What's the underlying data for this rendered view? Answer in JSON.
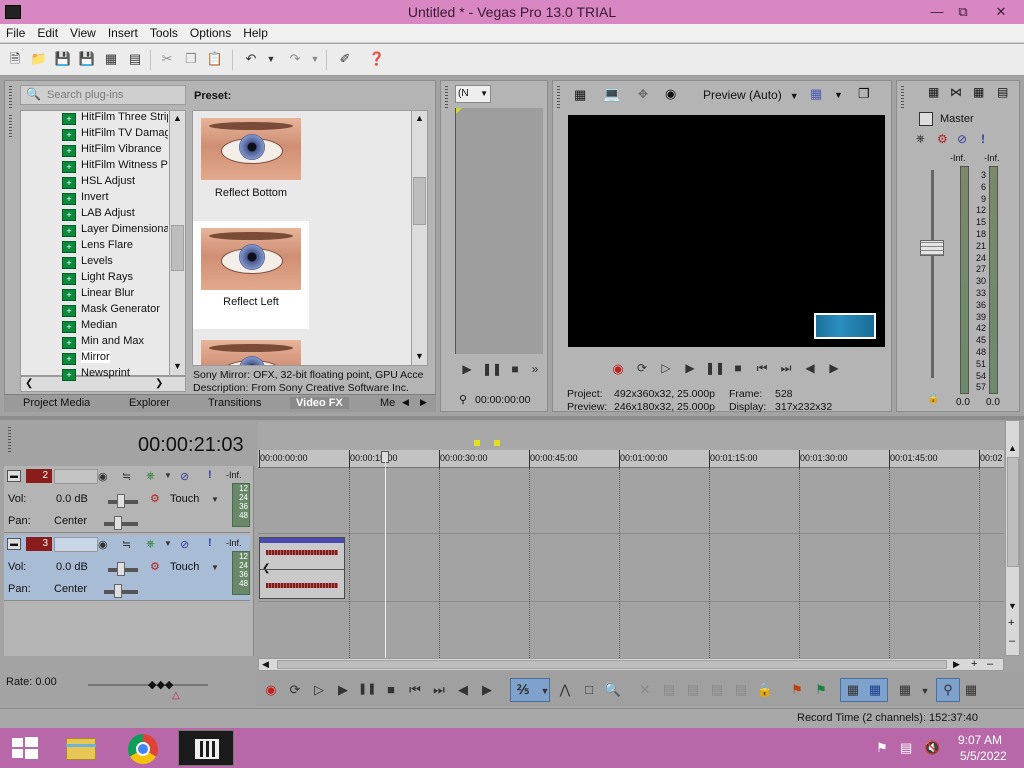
{
  "window": {
    "title": "Untitled * - Vegas Pro 13.0 TRIAL"
  },
  "menu": [
    "File",
    "Edit",
    "View",
    "Insert",
    "Tools",
    "Options",
    "Help"
  ],
  "plugins": {
    "search_placeholder": "Search plug-ins",
    "items": [
      "HitFilm Three Strip",
      "HitFilm TV Damage",
      "HitFilm Vibrance",
      "HitFilm Witness Pr",
      "HSL Adjust",
      "Invert",
      "LAB Adjust",
      "Layer Dimensional",
      "Lens Flare",
      "Levels",
      "Light Rays",
      "Linear Blur",
      "Mask Generator",
      "Median",
      "Min and Max",
      "Mirror",
      "Newsprint"
    ],
    "selected": "Mirror"
  },
  "preset": {
    "header": "Preset:",
    "items": [
      "Reflect Bottom",
      "Reflect Left",
      ""
    ],
    "desc1": "Sony Mirror: OFX, 32-bit floating point, GPU Acce",
    "desc2": "Description: From Sony Creative Software Inc."
  },
  "tabs": [
    "Project Media",
    "Explorer",
    "Transitions",
    "Video FX",
    "Me"
  ],
  "active_tab": "Video FX",
  "trimmer": {
    "select_value": "(N",
    "timecode": "00:00:00:00"
  },
  "preview": {
    "mode": "Preview (Auto)",
    "project_label": "Project:",
    "project_value": "492x360x32, 25.000p",
    "frame_label": "Frame:",
    "frame_value": "528",
    "preview_label": "Preview:",
    "preview_value": "246x180x32, 25.000p",
    "display_label": "Display:",
    "display_value": "317x232x32"
  },
  "mixer": {
    "name": "Master",
    "inf_left": "-Inf.",
    "inf_right": "-Inf.",
    "scale": [
      "3",
      "6",
      "9",
      "12",
      "15",
      "18",
      "21",
      "24",
      "27",
      "30",
      "33",
      "36",
      "39",
      "42",
      "45",
      "48",
      "51",
      "54",
      "57"
    ],
    "val_left": "0.0",
    "val_right": "0.0"
  },
  "timeline": {
    "timecode": "00:00:21:03",
    "ruler": [
      "00:00:00:00",
      "00:00:15:00",
      "00:00:30:00",
      "00:00:45:00",
      "00:01:00:00",
      "00:01:15:00",
      "00:01:30:00",
      "00:01:45:00",
      "00:02"
    ],
    "rate": "Rate: 0.00",
    "record_time": "Record Time (2 channels): 152:37:40"
  },
  "tracks": [
    {
      "number": "2",
      "vol_label": "Vol:",
      "vol_value": "0.0 dB",
      "pan_label": "Pan:",
      "pan_value": "Center",
      "mode": "Touch",
      "meter_top": "-Inf.",
      "meter": [
        "12",
        "24",
        "36",
        "48"
      ]
    },
    {
      "number": "3",
      "vol_label": "Vol:",
      "vol_value": "0.0 dB",
      "pan_label": "Pan:",
      "pan_value": "Center",
      "mode": "Touch",
      "meter_top": "-Inf.",
      "meter": [
        "12",
        "24",
        "36",
        "48"
      ]
    }
  ],
  "taskbar": {
    "time": "9:07 AM",
    "date": "5/5/2022"
  },
  "colors": {
    "titlebar": "#d987c3",
    "taskbar": "#b868a8",
    "track_number": "#8b1c1c",
    "selected_track": "#a9bcd6"
  }
}
